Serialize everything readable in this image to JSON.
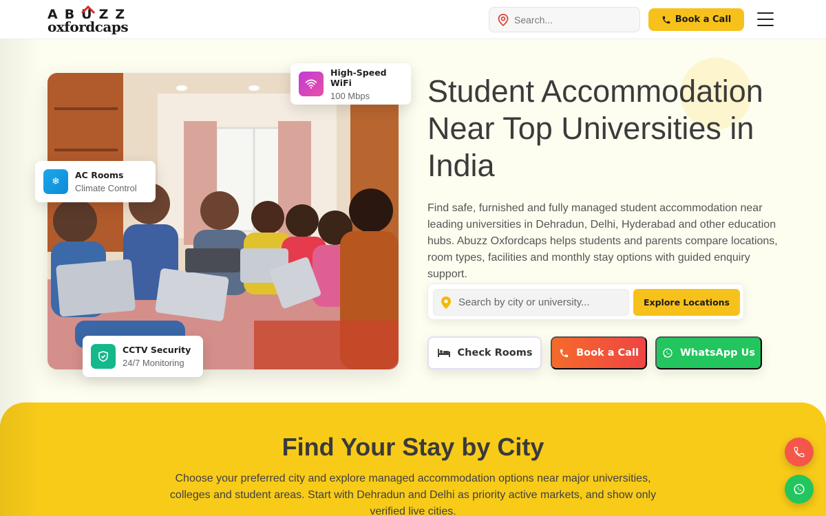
{
  "brand": {
    "top": "ABUZZ",
    "bottom": "oxfordcaps"
  },
  "header": {
    "search_placeholder": "Search...",
    "book_call": "Book a Call"
  },
  "hero": {
    "title": "Student Accommodation Near Top Universities in India",
    "description": "Find safe, furnished and fully managed student accommodation near leading universities in Dehradun, Delhi, Hyderabad and other education hubs. Abuzz Oxfordcaps helps students and parents compare locations, room types, facilities and monthly stay options with guided enquiry support.",
    "search_placeholder": "Search by city or university...",
    "explore_button": "Explore Locations",
    "cta": {
      "rooms": "Check Rooms",
      "call": "Book a Call",
      "whatsapp": "WhatsApp Us"
    }
  },
  "features": {
    "wifi": {
      "title": "High-Speed WiFi",
      "sub": "100 Mbps"
    },
    "ac": {
      "title": "AC Rooms",
      "sub": "Climate Control"
    },
    "cctv": {
      "title": "CCTV Security",
      "sub": "24/7 Monitoring"
    }
  },
  "city_section": {
    "title": "Find Your Stay by City",
    "description": "Choose your preferred city and explore managed accommodation options near major universities, colleges and student areas. Start with Dehradun and Delhi as priority active markets, and show only verified live cities."
  },
  "colors": {
    "accent_yellow": "#f7c11c",
    "section_yellow": "#f8cb19",
    "call_orange": "#f56b2a",
    "whatsapp_green": "#22c55e"
  }
}
